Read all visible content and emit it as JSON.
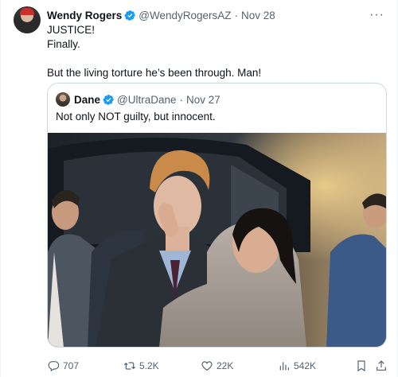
{
  "author": {
    "name": "Wendy Rogers",
    "handle": "@WendyRogersAZ",
    "separator": "·",
    "date": "Nov 28",
    "more_label": "···"
  },
  "tweet": {
    "lines": [
      "JUSTICE!",
      "Finally.",
      "But the living torture he’s been through. Man!"
    ]
  },
  "quote": {
    "name": "Dane",
    "handle": "@UltraDane",
    "separator": "·",
    "date": "Nov 27",
    "text": "Not only NOT guilty, but innocent."
  },
  "actions": {
    "replies": "707",
    "retweets": "5.2K",
    "likes": "22K",
    "views": "542K"
  },
  "icons": {
    "verified": "verified-badge-icon",
    "reply": "reply-icon",
    "retweet": "retweet-icon",
    "like": "heart-icon",
    "views": "views-bar-chart-icon",
    "bookmark": "bookmark-icon",
    "share": "share-icon"
  },
  "colors": {
    "text": "#0f1419",
    "secondary": "#536471",
    "verified": "#1d9bf0",
    "border": "#cfd9de"
  }
}
